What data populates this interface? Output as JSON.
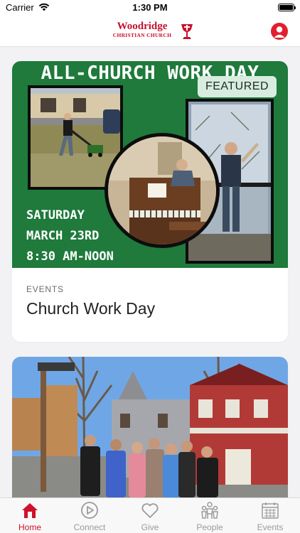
{
  "status_bar": {
    "carrier": "Carrier",
    "time": "1:30 PM",
    "battery_level": 1.0
  },
  "header": {
    "logo": {
      "name": "Woodridge",
      "subtitle": "CHRISTIAN CHURCH"
    },
    "profile_icon": "person-circle-icon",
    "brand_color": "#c8102e"
  },
  "feed": {
    "cards": [
      {
        "flyer": {
          "title": "ALL-CHURCH WORK DAY",
          "date_lines": [
            "SATURDAY",
            "MARCH 23RD",
            "8:30 AM-NOON"
          ],
          "background_color": "#1f7a3c"
        },
        "badge": "FEATURED",
        "category": "EVENTS",
        "title": "Church Work Day"
      },
      {
        "image": "group-photo"
      }
    ]
  },
  "tab_bar": {
    "active_color": "#d0102a",
    "inactive_color": "#9a9a9a",
    "tabs": [
      {
        "label": "Home",
        "icon": "home-icon",
        "active": true
      },
      {
        "label": "Connect",
        "icon": "play-circle-icon",
        "active": false
      },
      {
        "label": "Give",
        "icon": "heart-icon",
        "active": false
      },
      {
        "label": "People",
        "icon": "people-icon",
        "active": false
      },
      {
        "label": "Events",
        "icon": "calendar-icon",
        "active": false
      }
    ]
  }
}
